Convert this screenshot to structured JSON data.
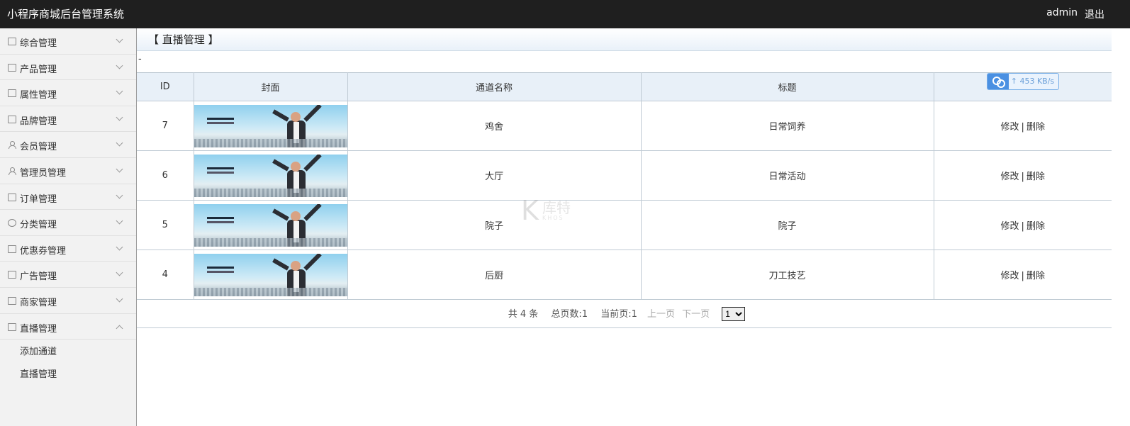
{
  "header": {
    "title": "小程序商城后台管理系统",
    "user": "admin",
    "logout": "退出"
  },
  "sidebar": {
    "items": [
      {
        "label": "综合管理",
        "icon": "document-icon"
      },
      {
        "label": "产品管理",
        "icon": "image-icon"
      },
      {
        "label": "属性管理",
        "icon": "image-icon"
      },
      {
        "label": "品牌管理",
        "icon": "lock-icon"
      },
      {
        "label": "会员管理",
        "icon": "user-icon"
      },
      {
        "label": "管理员管理",
        "icon": "admin-user-icon"
      },
      {
        "label": "订单管理",
        "icon": "list-icon"
      },
      {
        "label": "分类管理",
        "icon": "gear-icon"
      },
      {
        "label": "优惠券管理",
        "icon": "list-icon"
      },
      {
        "label": "广告管理",
        "icon": "list-icon"
      },
      {
        "label": "商家管理",
        "icon": "list-icon"
      },
      {
        "label": "直播管理",
        "icon": "list-icon",
        "expanded": true
      }
    ],
    "subitems": [
      {
        "label": "添加通道"
      },
      {
        "label": "直播管理"
      }
    ]
  },
  "main": {
    "page_title": "【 直播管理 】",
    "dash": "-",
    "table": {
      "columns": [
        "ID",
        "封面",
        "通道名称",
        "标题"
      ],
      "rows": [
        {
          "id": "7",
          "channel": "鸡舍",
          "title": "日常饲养",
          "edit": "修改",
          "sep": "|",
          "delete": "删除"
        },
        {
          "id": "6",
          "channel": "大厅",
          "title": "日常活动",
          "edit": "修改",
          "sep": "|",
          "delete": "删除"
        },
        {
          "id": "5",
          "channel": "院子",
          "title": "院子",
          "edit": "修改",
          "sep": "|",
          "delete": "删除"
        },
        {
          "id": "4",
          "channel": "后厨",
          "title": "刀工技艺",
          "edit": "修改",
          "sep": "|",
          "delete": "删除"
        }
      ]
    },
    "speed_badge": {
      "speed": "453 KB/s",
      "icon": "baidu-cloud-icon"
    },
    "pager": {
      "total": "共 4 条",
      "pages": "总页数:1",
      "current": "当前页:1",
      "prev": "上一页",
      "next": "下一页",
      "select_value": "1"
    }
  },
  "watermark": {
    "glyph": "K",
    "text": "库特",
    "sub": "KHOS"
  },
  "colors": {
    "topbar": "#1f1f1f",
    "sidebar": "#f2f2f2",
    "header_row": "#e8f0f8",
    "badge": "#4a90e2"
  }
}
